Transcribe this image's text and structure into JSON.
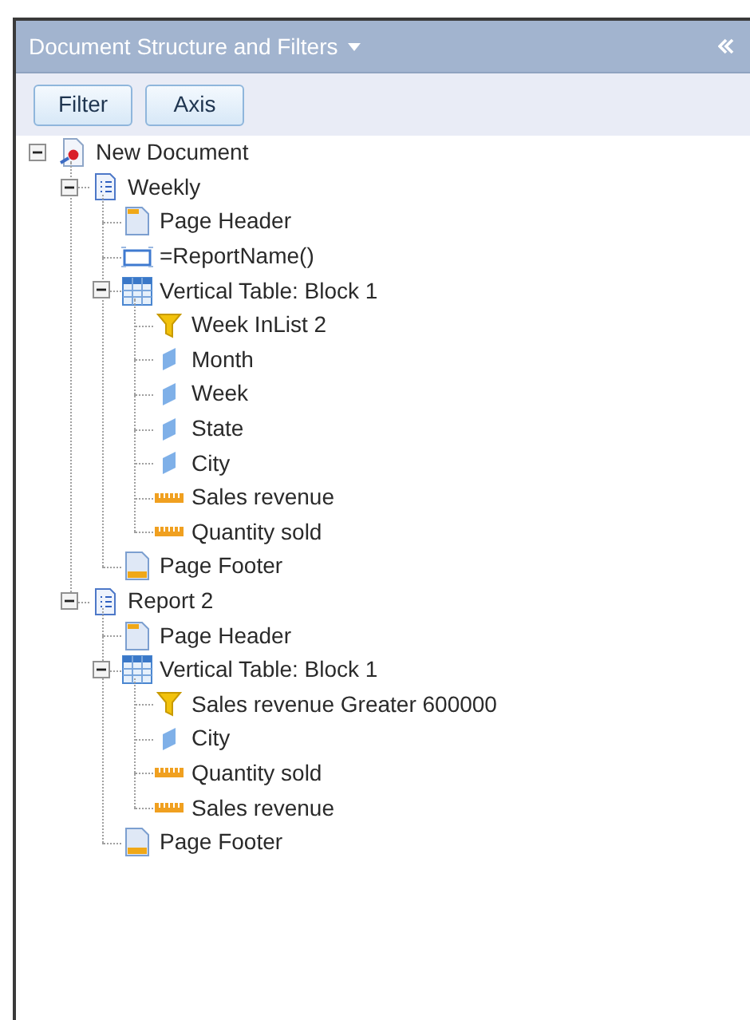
{
  "panel": {
    "title": "Document Structure and Filters"
  },
  "toolbar": {
    "buttons": [
      "Filter",
      "Axis"
    ]
  },
  "tree": [
    {
      "label": "New Document",
      "kind": "document",
      "expanded": true,
      "children": [
        {
          "label": "Weekly",
          "kind": "report",
          "expanded": true,
          "children": [
            {
              "label": "Page Header",
              "kind": "header"
            },
            {
              "label": "=ReportName()",
              "kind": "cell"
            },
            {
              "label": "Vertical Table: Block 1",
              "kind": "table",
              "expanded": true,
              "children": [
                {
                  "label": "Week InList 2",
                  "kind": "filter"
                },
                {
                  "label": "Month",
                  "kind": "dimension"
                },
                {
                  "label": "Week",
                  "kind": "dimension"
                },
                {
                  "label": "State",
                  "kind": "dimension"
                },
                {
                  "label": "City",
                  "kind": "dimension"
                },
                {
                  "label": "Sales revenue",
                  "kind": "measure"
                },
                {
                  "label": "Quantity sold",
                  "kind": "measure"
                }
              ]
            },
            {
              "label": "Page Footer",
              "kind": "footer"
            }
          ]
        },
        {
          "label": "Report 2",
          "kind": "report",
          "expanded": true,
          "children": [
            {
              "label": "Page Header",
              "kind": "header"
            },
            {
              "label": "Vertical Table: Block 1",
              "kind": "table",
              "expanded": true,
              "children": [
                {
                  "label": "Sales revenue Greater 600000",
                  "kind": "filter"
                },
                {
                  "label": "City",
                  "kind": "dimension"
                },
                {
                  "label": "Quantity sold",
                  "kind": "measure"
                },
                {
                  "label": "Sales revenue",
                  "kind": "measure"
                }
              ]
            },
            {
              "label": "Page Footer",
              "kind": "footer"
            }
          ]
        }
      ]
    }
  ]
}
